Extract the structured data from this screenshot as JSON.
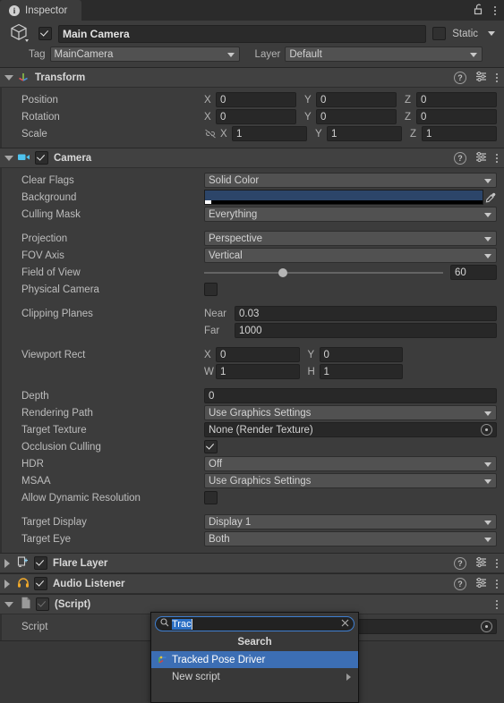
{
  "window": {
    "tab_label": "Inspector",
    "tab_icon": "info-circle-icon",
    "lock_icon": "padlock-unlocked-icon",
    "menu_icon": "kebab-menu-icon"
  },
  "gameobject": {
    "icon": "cube-icon",
    "enabled": true,
    "name": "Main Camera",
    "static_label": "Static",
    "static_checked": false,
    "tag_label": "Tag",
    "tag_value": "MainCamera",
    "layer_label": "Layer",
    "layer_value": "Default"
  },
  "components": [
    {
      "name": "Transform",
      "icon": "transform-axis-icon",
      "expanded": true,
      "has_enable_toggle": false,
      "rows": [
        {
          "label": "Position",
          "type": "vector3",
          "values": [
            "0",
            "0",
            "0"
          ],
          "axes": [
            "X",
            "Y",
            "Z"
          ]
        },
        {
          "label": "Rotation",
          "type": "vector3",
          "values": [
            "0",
            "0",
            "0"
          ],
          "axes": [
            "X",
            "Y",
            "Z"
          ]
        },
        {
          "label": "Scale",
          "type": "vector3",
          "values": [
            "1",
            "1",
            "1"
          ],
          "axes": [
            "X",
            "Y",
            "Z"
          ],
          "link_icon": "constrain-proportions-off-icon"
        }
      ]
    },
    {
      "name": "Camera",
      "icon": "camera-icon",
      "expanded": true,
      "has_enable_toggle": true,
      "enabled": true
    },
    {
      "name": "Flare Layer",
      "icon": "flare-layer-icon",
      "expanded": false,
      "has_enable_toggle": true,
      "enabled": true
    },
    {
      "name": "Audio Listener",
      "icon": "headphones-icon",
      "expanded": false,
      "has_enable_toggle": true,
      "enabled": true
    },
    {
      "name": "(Script)",
      "icon": "script-file-icon",
      "expanded": true,
      "has_enable_toggle": true,
      "enabled": true,
      "disabled_toggle": true
    }
  ],
  "camera": {
    "clear_flags": {
      "label": "Clear Flags",
      "value": "Solid Color"
    },
    "background": {
      "label": "Background",
      "color": "#2c4569",
      "alpha_color": "#000000",
      "eyedropper_icon": "eyedropper-icon"
    },
    "culling_mask": {
      "label": "Culling Mask",
      "value": "Everything"
    },
    "projection": {
      "label": "Projection",
      "value": "Perspective"
    },
    "fov_axis": {
      "label": "FOV Axis",
      "value": "Vertical"
    },
    "field_of_view": {
      "label": "Field of View",
      "value": "60",
      "slider_percent": 33
    },
    "physical_camera": {
      "label": "Physical Camera",
      "checked": false
    },
    "clipping_planes": {
      "label": "Clipping Planes",
      "near_label": "Near",
      "near_value": "0.03",
      "far_label": "Far",
      "far_value": "1000"
    },
    "viewport_rect": {
      "label": "Viewport Rect",
      "x_label": "X",
      "x_value": "0",
      "y_label": "Y",
      "y_value": "0",
      "w_label": "W",
      "w_value": "1",
      "h_label": "H",
      "h_value": "1"
    },
    "depth": {
      "label": "Depth",
      "value": "0"
    },
    "rendering_path": {
      "label": "Rendering Path",
      "value": "Use Graphics Settings"
    },
    "target_texture": {
      "label": "Target Texture",
      "value": "None (Render Texture)",
      "picker_icon": "object-picker-icon"
    },
    "occlusion_culling": {
      "label": "Occlusion Culling",
      "checked": true
    },
    "hdr": {
      "label": "HDR",
      "value": "Off"
    },
    "msaa": {
      "label": "MSAA",
      "value": "Use Graphics Settings"
    },
    "allow_dynamic_resolution": {
      "label": "Allow Dynamic Resolution",
      "checked": false
    },
    "target_display": {
      "label": "Target Display",
      "value": "Display 1"
    },
    "target_eye": {
      "label": "Target Eye",
      "value": "Both"
    }
  },
  "script_component": {
    "script_label": "Script",
    "script_value": "",
    "picker_icon": "object-picker-icon"
  },
  "search_popup": {
    "search_icon": "magnifier-icon",
    "query": "Trac",
    "clear_icon": "close-x-icon",
    "title": "Search",
    "items": [
      {
        "label": "Tracked Pose Driver",
        "selected": true,
        "icon": "script-asset-icon"
      },
      {
        "label": "New script",
        "selected": false,
        "submenu_icon": "chevron-right-icon"
      }
    ]
  },
  "colors": {
    "accent_blue": "#3c6eb4",
    "panel": "#3c3c3c",
    "header": "#414141",
    "field": "#282828"
  }
}
